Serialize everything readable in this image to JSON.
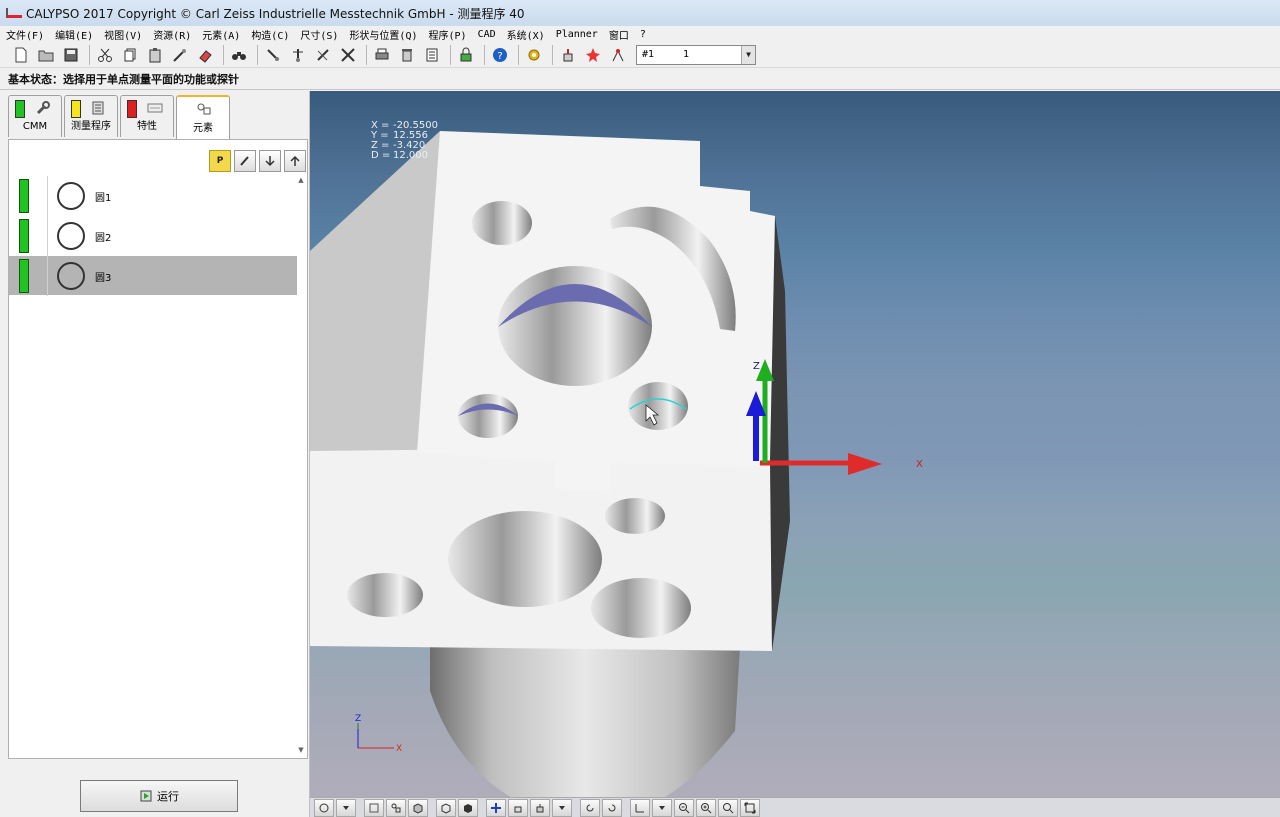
{
  "window": {
    "title": "CALYPSO 2017 Copyright © Carl Zeiss Industrielle Messtechnik GmbH - 测量程序 40"
  },
  "menu": {
    "items": [
      "文件(F)",
      "编辑(E)",
      "视图(V)",
      "资源(R)",
      "元素(A)",
      "构造(C)",
      "尺寸(S)",
      "形状与位置(Q)",
      "程序(P)",
      "CAD",
      "系统(X)",
      "Planner",
      "窗口",
      "?"
    ]
  },
  "toolbar": {
    "icons": [
      "new-file-icon",
      "open-folder-icon",
      "save-icon",
      "cut-icon",
      "copy-icon",
      "paste-icon",
      "wand-icon",
      "eraser-icon",
      "binoculars-icon",
      "probe-icon",
      "probe-config-icon",
      "stylus-icon",
      "tools-icon",
      "print-icon",
      "trash-icon",
      "report-icon",
      "lock-icon",
      "help-icon",
      "gear-icon",
      "hand-probe-icon",
      "star-icon",
      "cmm-icon"
    ],
    "select_values": {
      "primary": "#1",
      "secondary": "1"
    }
  },
  "status": {
    "text": "基本状态：选择用于单点测量平面的功能或探针"
  },
  "left_panel": {
    "tabs": [
      {
        "label": "CMM",
        "swatch": "#21c521",
        "icon": "wrench-icon"
      },
      {
        "label": "测量程序",
        "swatch": "#f5e51a",
        "icon": "program-icon"
      },
      {
        "label": "特性",
        "swatch": "#e21f1f",
        "icon": "characteristic-icon"
      },
      {
        "label": "元素",
        "swatch": "",
        "icon": "features-icon"
      }
    ],
    "features": [
      {
        "label": "圆1",
        "status_color": "#21c521"
      },
      {
        "label": "圆2",
        "status_color": "#21c521"
      },
      {
        "label": "圆3",
        "status_color": "#21c521"
      }
    ],
    "run_button": "运行"
  },
  "viewport": {
    "coords": [
      {
        "k": "X =",
        "v": "-20.5500"
      },
      {
        "k": "Y =",
        "v": "12.556"
      },
      {
        "k": "Z =",
        "v": "-3.420"
      },
      {
        "k": "D =",
        "v": "12.000"
      }
    ],
    "axis_labels": {
      "x": "X",
      "z": "Z"
    },
    "mini_axis_labels": {
      "x": "X",
      "z": "Z"
    }
  }
}
